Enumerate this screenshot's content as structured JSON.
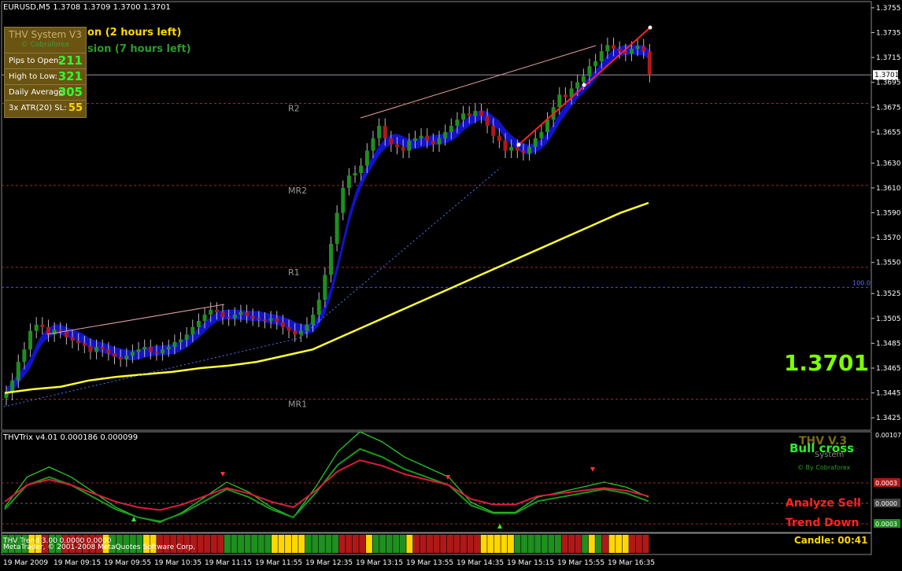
{
  "header": {
    "symbol_line": "EURUSD,M5  1.3708 1.3709 1.3700 1.3701"
  },
  "info_panel": {
    "title": "THV System V3",
    "subtitle": "© Cobraforex",
    "rows": [
      {
        "label": "Pips to Open:",
        "value": "211"
      },
      {
        "label": "High to Low:",
        "value": "321"
      },
      {
        "label": "Daily Average:",
        "value": "305"
      },
      {
        "label": "3x ATR(20) SL:",
        "value": "55"
      }
    ]
  },
  "sessions": {
    "line1": "on (2 hours left)",
    "line2": "sion (7 hours left)"
  },
  "current_price_big": "1.3701",
  "pivot_labels": [
    "R2",
    "MR2",
    "R1",
    "MR1"
  ],
  "fib_label": "100.0",
  "price_axis": {
    "ticks": [
      "1.3755",
      "1.3735",
      "1.3715",
      "1.3695",
      "1.3675",
      "1.3655",
      "1.3630",
      "1.3610",
      "1.3590",
      "1.3570",
      "1.3550",
      "1.3525",
      "1.3505",
      "1.3485",
      "1.3465",
      "1.3445",
      "1.3425"
    ],
    "current_marker": "1.3701"
  },
  "time_axis": {
    "ticks": [
      "19 Mar 2009",
      "19 Mar 09:15",
      "19 Mar 09:55",
      "19 Mar 10:35",
      "19 Mar 11:15",
      "19 Mar 11:55",
      "19 Mar 12:35",
      "19 Mar 13:15",
      "19 Mar 13:55",
      "19 Mar 14:35",
      "19 Mar 15:15",
      "19 Mar 15:55",
      "19 Mar 16:35"
    ]
  },
  "indicator": {
    "label": "THVTrix v4.01 0.000186 0.000099",
    "axis_ticks": [
      "0.00107",
      "0.0003",
      "0.0000",
      "0.0003"
    ],
    "brand": "THV V.3",
    "signal": "Bull cross",
    "system": "System",
    "by": "© By Cobraforex",
    "analyze": "Analyze Sell",
    "trend": "Trend Down",
    "candle": "Candle:  00:41",
    "trend_label": "THV Trend 3.00 0.0000 0.0000",
    "copyright": "MetaTrader, © 2001-2008 MetaQuotes Software Corp."
  },
  "colors": {
    "bull": "#1f8f1f",
    "bear": "#b01818",
    "ma_yellow": "#ffff33",
    "cloud_blue": "#1414dd",
    "trend_bar_green": "#1f8f1f",
    "trend_bar_red": "#b01818",
    "trend_bar_yellow": "#ffd700"
  },
  "chart_data": {
    "type": "candlestick",
    "symbol": "EURUSD",
    "timeframe": "M5",
    "ylim": [
      1.3415,
      1.376
    ],
    "current_price": 1.3701,
    "close_series": [
      1.3445,
      1.3455,
      1.347,
      1.348,
      1.3495,
      1.35,
      1.3498,
      1.3492,
      1.3496,
      1.3495,
      1.349,
      1.3487,
      1.3485,
      1.3483,
      1.3478,
      1.3482,
      1.348,
      1.3477,
      1.3474,
      1.3472,
      1.3475,
      1.3478,
      1.348,
      1.3482,
      1.3478,
      1.3477,
      1.348,
      1.3482,
      1.3486,
      1.3488,
      1.3492,
      1.3498,
      1.3503,
      1.3508,
      1.3512,
      1.351,
      1.3506,
      1.3505,
      1.3508,
      1.351,
      1.3507,
      1.3505,
      1.3504,
      1.3503,
      1.3505,
      1.3502,
      1.3498,
      1.3495,
      1.3492,
      1.3495,
      1.35,
      1.3508,
      1.352,
      1.354,
      1.3565,
      1.359,
      1.361,
      1.362,
      1.3622,
      1.3628,
      1.364,
      1.365,
      1.366,
      1.365,
      1.3645,
      1.3643,
      1.364,
      1.3648,
      1.365,
      1.3652,
      1.3648,
      1.3645,
      1.365,
      1.3655,
      1.366,
      1.3665,
      1.367,
      1.3668,
      1.3672,
      1.3668,
      1.366,
      1.3652,
      1.3648,
      1.364,
      1.3643,
      1.364,
      1.3638,
      1.3643,
      1.365,
      1.3655,
      1.3665,
      1.3675,
      1.3685,
      1.3683,
      1.369,
      1.3695,
      1.37,
      1.3708,
      1.3712,
      1.372,
      1.3725,
      1.3722,
      1.372,
      1.3718,
      1.3722,
      1.3724,
      1.372,
      1.3701
    ],
    "ma_yellow": [
      1.3445,
      1.3448,
      1.345,
      1.3455,
      1.3458,
      1.346,
      1.3462,
      1.3465,
      1.3467,
      1.347,
      1.3475,
      1.348,
      1.349,
      1.35,
      1.351,
      1.352,
      1.353,
      1.354,
      1.355,
      1.356,
      1.357,
      1.358,
      1.359,
      1.3598
    ],
    "pivots": [
      {
        "name": "R2",
        "value": 1.3678
      },
      {
        "name": "MR2",
        "value": 1.3612
      },
      {
        "name": "R1",
        "value": 1.3546
      },
      {
        "name": "MR1",
        "value": 1.344
      }
    ],
    "fib_100": 1.353,
    "indicator_series": [
      {
        "name": "THVTrix",
        "values": [
          2e-05,
          8e-05,
          0.0001,
          8e-05,
          5e-05,
          2e-05,
          0.0,
          -1e-05,
          1e-05,
          4e-05,
          7e-05,
          5e-05,
          2e-05,
          0.0,
          6e-05,
          0.00013,
          0.00017,
          0.00015,
          0.00012,
          0.0001,
          8e-05,
          3e-05,
          1e-05,
          1e-05,
          4e-05,
          5e-05,
          6e-05,
          7e-05,
          6e-05,
          4e-05
        ]
      }
    ]
  }
}
